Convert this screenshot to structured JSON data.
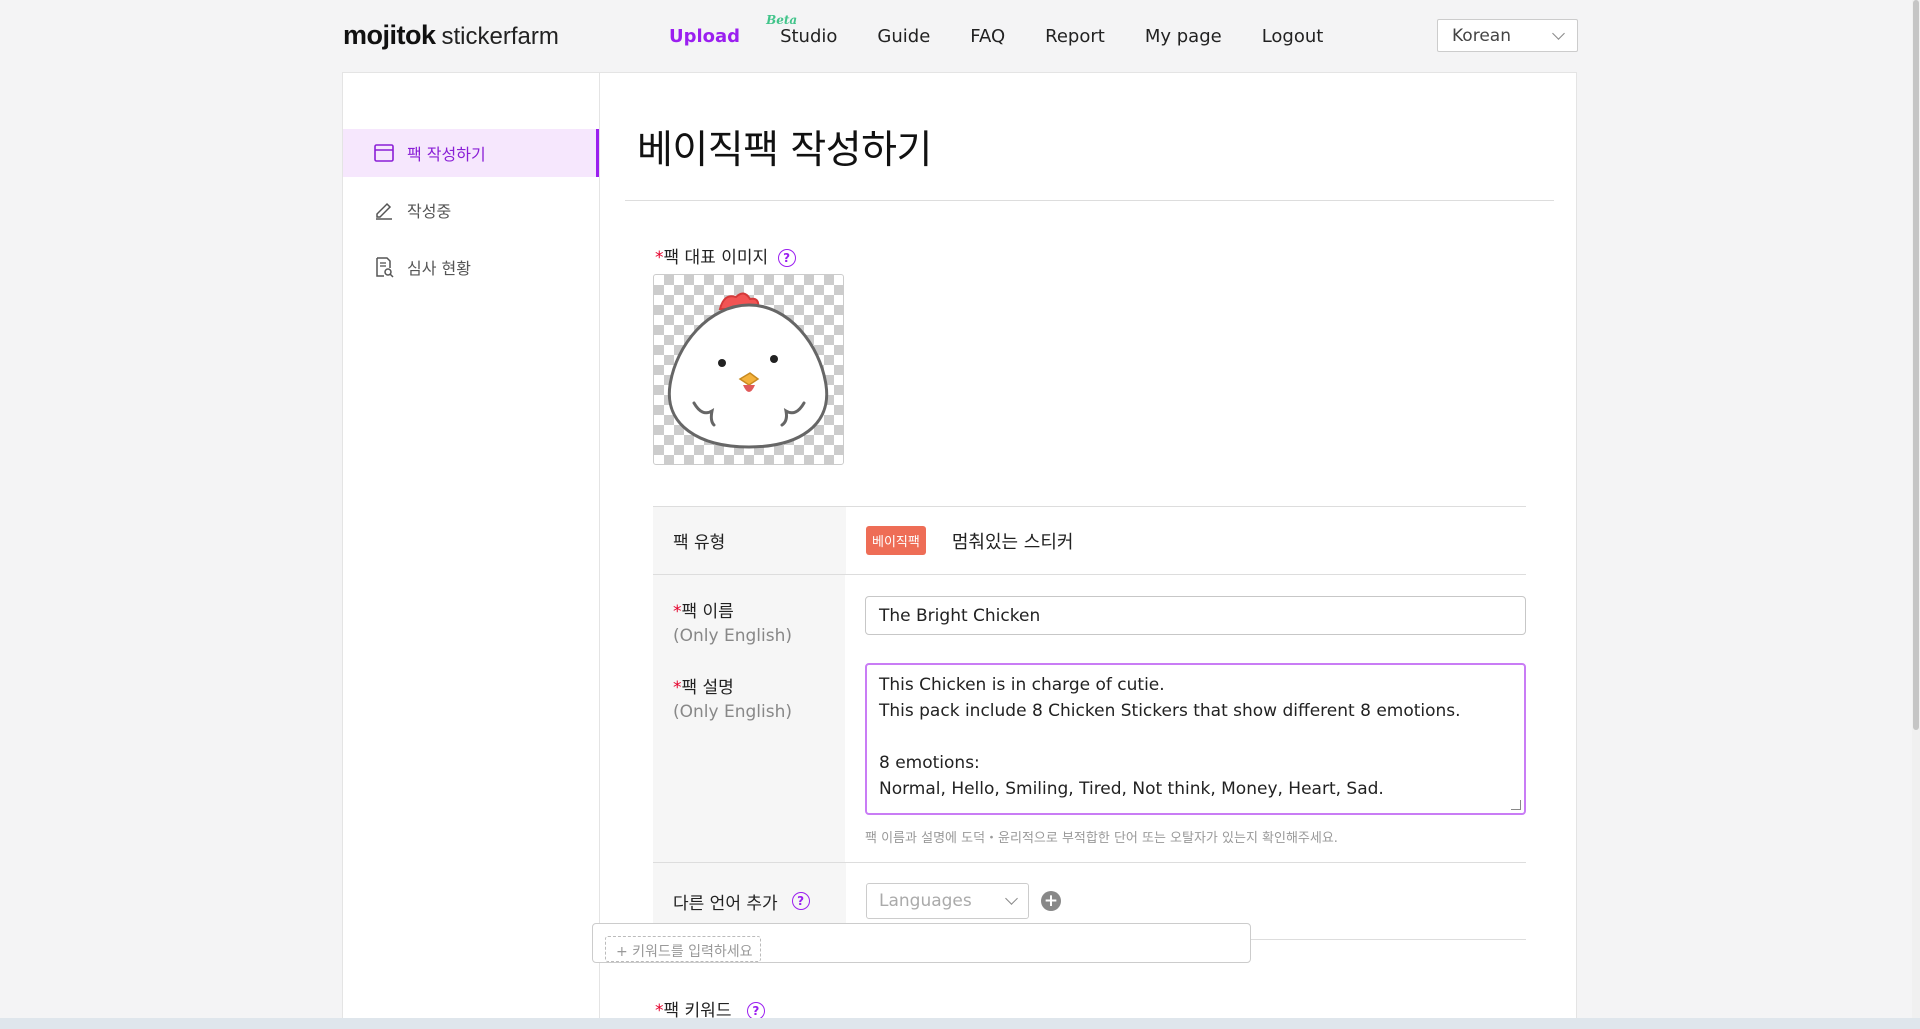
{
  "header": {
    "logo_primary": "mojitok",
    "logo_secondary": "stickerfarm",
    "nav": [
      {
        "label": "Upload",
        "active": true
      },
      {
        "label": "Studio",
        "badge": "Beta"
      },
      {
        "label": "Guide"
      },
      {
        "label": "FAQ"
      },
      {
        "label": "Report"
      },
      {
        "label": "My page"
      },
      {
        "label": "Logout"
      }
    ],
    "language": "Korean"
  },
  "sidebar": {
    "items": [
      {
        "label": "팩 작성하기",
        "icon": "calendar-icon",
        "active": true
      },
      {
        "label": "작성중",
        "icon": "pencil-icon"
      },
      {
        "label": "심사 현황",
        "icon": "document-search-icon"
      }
    ]
  },
  "main": {
    "title": "베이직팩 작성하기",
    "rep_image": {
      "required_mark": "*",
      "label": "팩 대표 이미지",
      "help": "?"
    },
    "pack_type": {
      "label": "팩 유형",
      "badge": "베이직팩",
      "value": "멈춰있는 스티커"
    },
    "pack_name": {
      "required_mark": "*",
      "label": "팩 이름",
      "hint": "(Only English)",
      "value": "The Bright Chicken"
    },
    "pack_desc": {
      "required_mark": "*",
      "label": "팩 설명",
      "hint": "(Only English)",
      "lines": [
        "This Chicken is in charge of cutie.",
        "This pack include 8 Chicken Stickers that show different 8 emotions.",
        "",
        "8 emotions:",
        "Normal, Hello, Smiling, Tired, Not think, Money, Heart, Sad."
      ],
      "note": "팩 이름과 설명에 도덕・윤리적으로 부적합한 단어 또는 오탈자가 있는지 확인해주세요."
    },
    "other_lang": {
      "label": "다른 언어 추가",
      "help": "?",
      "placeholder": "Languages",
      "add": "+"
    },
    "keywords": {
      "required_mark": "*",
      "label": "팩 키워드",
      "help": "?",
      "tag_placeholder": "+ 키워드를 입력하세요"
    }
  },
  "colors": {
    "accent": "#9b1ff0",
    "badge": "#ee6d56",
    "active_bg": "#f6e7fd"
  }
}
